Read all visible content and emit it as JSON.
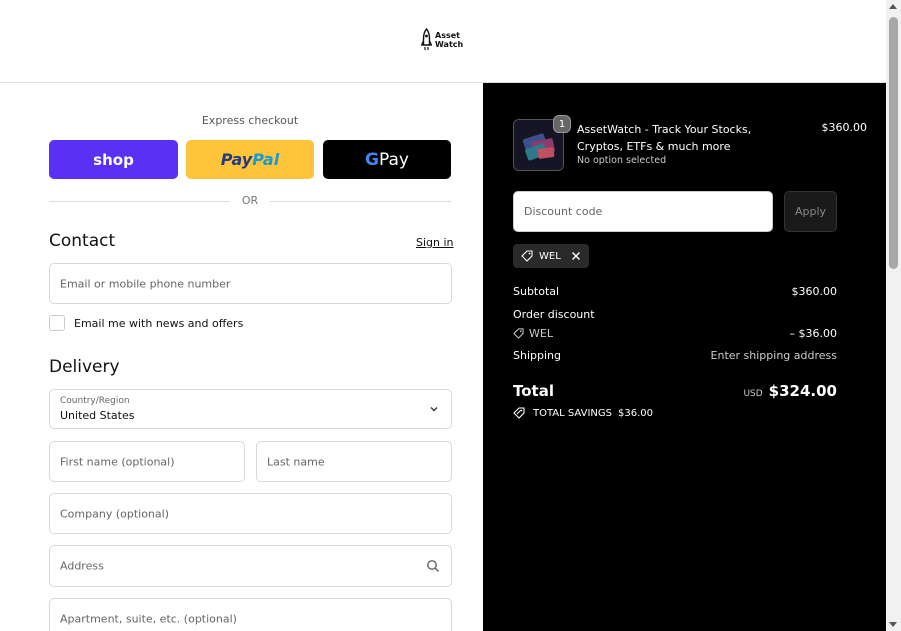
{
  "header": {
    "logo_line1": "Asset",
    "logo_line2": "Watch"
  },
  "express": {
    "title": "Express checkout",
    "shop_label": "shop",
    "paypal_part1": "Pay",
    "paypal_part2": "Pal",
    "gpay_g": "G",
    "gpay_label": " Pay",
    "or_label": "OR"
  },
  "contact": {
    "title": "Contact",
    "signin_label": "Sign in",
    "email_placeholder": "Email or mobile phone number",
    "newsletter_label": "Email me with news and offers"
  },
  "delivery": {
    "title": "Delivery",
    "country_label": "Country/Region",
    "country_value": "United States",
    "first_name_placeholder": "First name (optional)",
    "last_name_placeholder": "Last name",
    "company_placeholder": "Company (optional)",
    "address_placeholder": "Address",
    "apartment_placeholder": "Apartment, suite, etc. (optional)"
  },
  "summary": {
    "product": {
      "quantity": "1",
      "name": "AssetWatch - Track Your Stocks, Cryptos, ETFs & much more",
      "option": "No option selected",
      "price": "$360.00"
    },
    "discount_placeholder": "Discount code",
    "apply_label": "Apply",
    "applied_code": "WEL",
    "subtotal_label": "Subtotal",
    "subtotal_value": "$360.00",
    "order_discount_label": "Order discount",
    "discount_code": "WEL",
    "discount_value": "– $36.00",
    "shipping_label": "Shipping",
    "shipping_value": "Enter shipping address",
    "total_label": "Total",
    "currency": "USD",
    "total_value": "$324.00",
    "savings_label": "TOTAL SAVINGS",
    "savings_value": "$36.00"
  },
  "colors": {
    "shop_purple": "#5a31f4",
    "paypal_yellow": "#ffc439",
    "summary_bg": "#000000"
  }
}
